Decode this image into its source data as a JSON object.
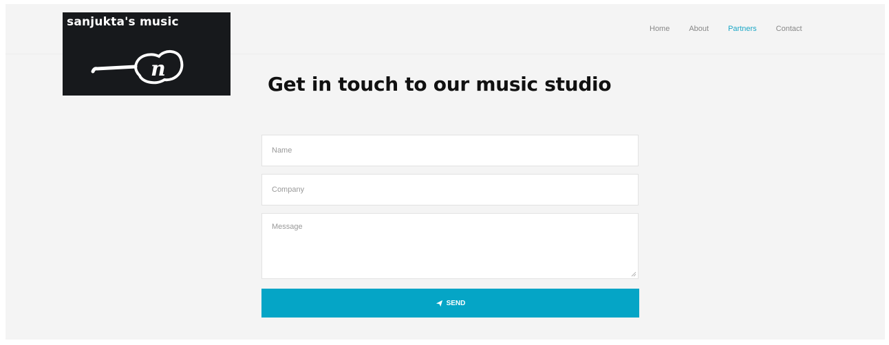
{
  "logo": {
    "text": "sanjukta's music",
    "icon": "guitar-icon"
  },
  "nav": {
    "items": [
      {
        "label": "Home",
        "active": false
      },
      {
        "label": "About",
        "active": false
      },
      {
        "label": "Partners",
        "active": true
      },
      {
        "label": "Contact",
        "active": false
      }
    ]
  },
  "main": {
    "heading": "Get in touch to our music studio"
  },
  "form": {
    "name_placeholder": "Name",
    "company_placeholder": "Company",
    "message_placeholder": "Message",
    "send_label": "SEND",
    "send_icon": "paper-plane-icon"
  },
  "colors": {
    "accent": "#05a5c6",
    "nav_active": "#1ba7c6",
    "page_bg": "#f4f4f4",
    "logo_bg": "#17191c"
  }
}
